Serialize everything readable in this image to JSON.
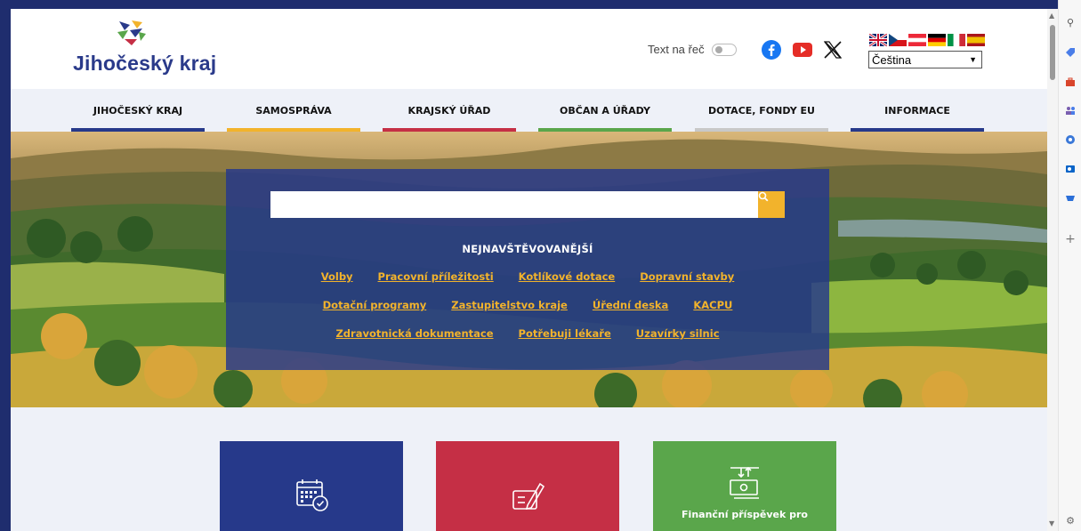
{
  "header": {
    "logo_text": "Jihočeský kraj",
    "tts_label": "Text na řeč",
    "language": {
      "selected": "Čeština",
      "flags": [
        "gb-flag",
        "cz-flag",
        "at-flag",
        "de-flag",
        "it-flag",
        "es-flag"
      ]
    }
  },
  "nav": {
    "items": [
      {
        "label": "JIHOČESKÝ KRAJ",
        "color": "#26398a"
      },
      {
        "label": "SAMOSPRÁVA",
        "color": "#f2b32c"
      },
      {
        "label": "KRAJSKÝ ÚŘAD",
        "color": "#c52f45"
      },
      {
        "label": "OBČAN A ÚŘADY",
        "color": "#5aa64b"
      },
      {
        "label": "DOTACE, FONDY EU",
        "color": "#c8c8c8"
      },
      {
        "label": "INFORMACE",
        "color": "#26398a"
      }
    ]
  },
  "search": {
    "placeholder": "",
    "popular_title": "NEJNAVŠTĚVOVANĚJŠÍ",
    "links_row1": [
      "Volby",
      "Pracovní příležitosti",
      "Kotlíkové dotace",
      "Dopravní stavby"
    ],
    "links_row2": [
      "Dotační programy",
      "Zastupitelstvo kraje",
      "Úřední deska",
      "KACPU"
    ],
    "links_row3": [
      "Zdravotnická dokumentace",
      "Potřebuji lékaře",
      "Uzavírky silnic"
    ]
  },
  "tiles": [
    {
      "label": "",
      "icon": "calendar-check-icon",
      "color": "#26398a"
    },
    {
      "label": "",
      "icon": "form-pen-icon",
      "color": "#c52f45"
    },
    {
      "label": "Finanční příspěvek pro",
      "icon": "money-transfer-icon",
      "color": "#5aa64b"
    }
  ],
  "colors": {
    "brand_blue": "#26398a",
    "accent_yellow": "#f2b32c",
    "red": "#c52f45",
    "green": "#5aa64b"
  }
}
